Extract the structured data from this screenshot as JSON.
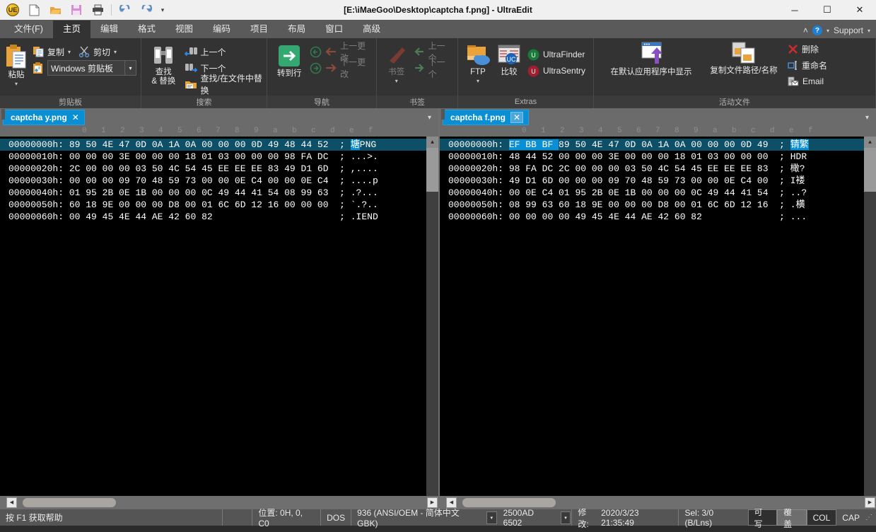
{
  "window": {
    "title": "[E:\\iMaeGoo\\Desktop\\captcha f.png] - UltraEdit",
    "logo_text": "UE",
    "minimize": "─",
    "maximize": "☐",
    "close": "✕"
  },
  "quick_access": {
    "new": "new-document-icon",
    "open": "open-folder-icon",
    "save": "save-disk-icon",
    "print": "printer-icon",
    "undo": "undo-icon",
    "redo": "redo-icon",
    "more": "▾"
  },
  "ribbon_tabs": [
    {
      "label": "文件(F)",
      "active": false
    },
    {
      "label": "主页",
      "active": true
    },
    {
      "label": "编辑",
      "active": false
    },
    {
      "label": "格式",
      "active": false
    },
    {
      "label": "视图",
      "active": false
    },
    {
      "label": "编码",
      "active": false
    },
    {
      "label": "项目",
      "active": false
    },
    {
      "label": "布局",
      "active": false
    },
    {
      "label": "窗口",
      "active": false
    },
    {
      "label": "高级",
      "active": false
    }
  ],
  "ribbon_right": {
    "collapse": "˄",
    "help": "?",
    "help_caret": "▾",
    "support": "Support",
    "support_caret": "▾"
  },
  "groups": {
    "clipboard": {
      "title": "剪贴板",
      "paste": "粘贴",
      "paste_caret": "▾",
      "copy": "复制",
      "copy_caret": "▾",
      "cut": "剪切",
      "cut_caret": "▾",
      "clipboard_combo": "Windows 剪贴板",
      "combo_caret": "▾"
    },
    "search": {
      "title": "搜索",
      "find_replace_line1": "查找",
      "find_replace_line2": "& 替换",
      "prev": "上一个",
      "next": "下一个",
      "find_in_files": "查找/在文件中替换"
    },
    "navigation": {
      "title": "导航",
      "goto_line": "转到行",
      "back": "back-arrow-icon",
      "forward": "forward-arrow-icon",
      "prev_change": "上一更改",
      "next_change": "下一更改"
    },
    "bookmark": {
      "title": "书签",
      "bookmark": "书签",
      "bookmark_caret": "▾",
      "prev": "上一个",
      "next": "下一个"
    },
    "extras": {
      "title": "Extras",
      "ftp": "FTP",
      "ftp_caret": "▾",
      "compare": "比较",
      "ultrafinder": "UltraFinder",
      "ultrasentry": "UltraSentry"
    },
    "active_files": {
      "title": "活动文件",
      "show_in_default_app": "在默认应用程序中显示",
      "copy_path": "复制文件路径/名称",
      "delete": "删除",
      "rename": "重命名",
      "email": "Email"
    }
  },
  "ruler_labels": [
    "0",
    "1",
    "2",
    "3",
    "4",
    "5",
    "6",
    "7",
    "8",
    "9",
    "a",
    "b",
    "c",
    "d",
    "e",
    "f"
  ],
  "panes": [
    {
      "tab_label": "captcha y.png",
      "tab_close": "✕",
      "tab_close_boxed": false,
      "tabbar_caret": "▾",
      "lines": [
        {
          "offset": "00000000h:",
          "bytes": "89 50 4E 47 0D 0A 1A 0A 00 00 00 0D 49 48 44 52",
          "sel_bytes": 0,
          "selected": true,
          "ascii_hl": "塘",
          "ascii": "PNG"
        },
        {
          "offset": "00000010h:",
          "bytes": "00 00 00 3E 00 00 00 18 01 03 00 00 00 98 FA DC",
          "sel_bytes": 0,
          "selected": false,
          "ascii_hl": "",
          "ascii": "...>."
        },
        {
          "offset": "00000020h:",
          "bytes": "2C 00 00 00 03 50 4C 54 45 EE EE EE 83 49 D1 6D",
          "sel_bytes": 0,
          "selected": false,
          "ascii_hl": "",
          "ascii": ",...."
        },
        {
          "offset": "00000030h:",
          "bytes": "00 00 00 09 70 48 59 73 00 00 0E C4 00 00 0E C4",
          "sel_bytes": 0,
          "selected": false,
          "ascii_hl": "",
          "ascii": "....p"
        },
        {
          "offset": "00000040h:",
          "bytes": "01 95 2B 0E 1B 00 00 00 0C 49 44 41 54 08 99 63",
          "sel_bytes": 0,
          "selected": false,
          "ascii_hl": "",
          "ascii": ".?..."
        },
        {
          "offset": "00000050h:",
          "bytes": "60 18 9E 00 00 00 D8 00 01 6C 6D 12 16 00 00 00",
          "sel_bytes": 0,
          "selected": false,
          "ascii_hl": "",
          "ascii": "`.?.."
        },
        {
          "offset": "00000060h:",
          "bytes": "00 49 45 4E 44 AE 42 60 82",
          "sel_bytes": 0,
          "selected": false,
          "ascii_hl": "",
          "ascii": ".IEND"
        }
      ]
    },
    {
      "tab_label": "captcha f.png",
      "tab_close": "✕",
      "tab_close_boxed": true,
      "tabbar_caret": "▾",
      "lines": [
        {
          "offset": "00000000h:",
          "bytes": "EF BB BF 89 50 4E 47 0D 0A 1A 0A 00 00 00 0D 49",
          "sel_bytes": 3,
          "selected": true,
          "ascii_hl": "锖繁",
          "ascii": ""
        },
        {
          "offset": "00000010h:",
          "bytes": "48 44 52 00 00 00 3E 00 00 00 18 01 03 00 00 00",
          "sel_bytes": 0,
          "selected": false,
          "ascii_hl": "",
          "ascii": "HDR"
        },
        {
          "offset": "00000020h:",
          "bytes": "98 FA DC 2C 00 00 00 03 50 4C 54 45 EE EE EE 83",
          "sel_bytes": 0,
          "selected": false,
          "ascii_hl": "",
          "ascii": "橄?"
        },
        {
          "offset": "00000030h:",
          "bytes": "49 D1 6D 00 00 00 09 70 48 59 73 00 00 0E C4 00",
          "sel_bytes": 0,
          "selected": false,
          "ascii_hl": "",
          "ascii": "I褛"
        },
        {
          "offset": "00000040h:",
          "bytes": "00 0E C4 01 95 2B 0E 1B 00 00 00 0C 49 44 41 54",
          "sel_bytes": 0,
          "selected": false,
          "ascii_hl": "",
          "ascii": "..?"
        },
        {
          "offset": "00000050h:",
          "bytes": "08 99 63 60 18 9E 00 00 00 D8 00 01 6C 6D 12 16",
          "sel_bytes": 0,
          "selected": false,
          "ascii_hl": "",
          "ascii": ".横"
        },
        {
          "offset": "00000060h:",
          "bytes": "00 00 00 00 49 45 4E 44 AE 42 60 82",
          "sel_bytes": 0,
          "selected": false,
          "ascii_hl": "",
          "ascii": "..."
        }
      ]
    }
  ],
  "statusbar": {
    "help_hint": "按 F1 获取帮助",
    "position": "位置: 0H, 0, C0",
    "line_ending": "DOS",
    "codepage": "936   (ANSI/OEM - 简体中文 GBK)",
    "codepage_caret": "▾",
    "charinfo": "2500AD 6502",
    "charinfo_caret": "▾",
    "modified_label": "修改:",
    "modified_value": "2020/3/23 21:35:49",
    "selection": "Sel: 3/0 (B/Lns)",
    "writable": "可写",
    "overwrite": "覆盖",
    "col": "COL",
    "cap": "CAP",
    "grip": "⋰"
  },
  "scroll": {
    "up": "▲",
    "down": "▼",
    "left": "◀",
    "right": "▶"
  }
}
